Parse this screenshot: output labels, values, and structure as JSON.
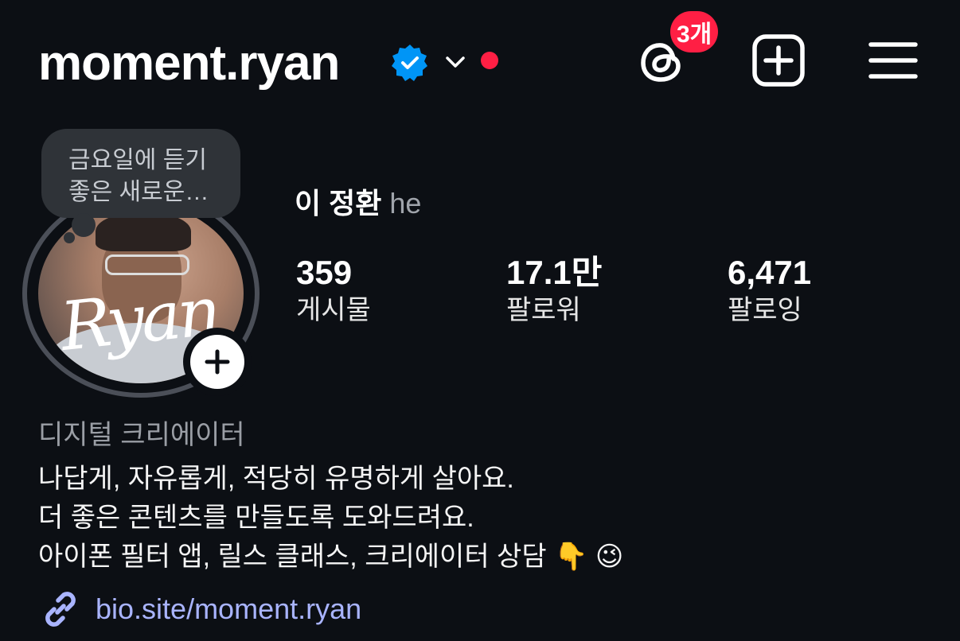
{
  "header": {
    "username": "moment.ryan",
    "threads_badge": "3개"
  },
  "note": {
    "line1": "금요일에 듣기",
    "line2": "좋은 새로운…"
  },
  "profile": {
    "name": "이 정환",
    "pronoun": "he",
    "signature": "Ryan"
  },
  "stats": [
    {
      "value": "359",
      "label": "게시물"
    },
    {
      "value": "17.1만",
      "label": "팔로워"
    },
    {
      "value": "6,471",
      "label": "팔로잉"
    }
  ],
  "bio": {
    "category": "디지털 크리에이터",
    "lines": [
      "나답게, 자유롭게, 적당히 유명하게 살아요.",
      "더 좋은 콘텐츠를 만들도록 도와드려요.",
      "아이폰 필터 앱, 릴스 클래스, 크리에이터 상담 👇 😉"
    ],
    "link": "bio.site/moment.ryan"
  },
  "icons": {
    "verified": "verified-badge-icon",
    "chevron": "chevron-down-icon",
    "threads": "threads-icon",
    "create": "plus-square-icon",
    "menu": "hamburger-menu-icon",
    "link": "link-icon"
  },
  "colors": {
    "background": "#0c0f14",
    "accent_red": "#ff1f44",
    "verified_blue": "#0095f6",
    "link_blue": "#a9b4ff"
  }
}
